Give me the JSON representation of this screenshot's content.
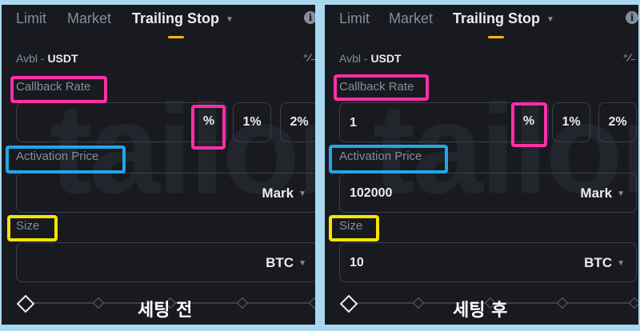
{
  "panels": [
    {
      "tabs": [
        "Limit",
        "Market",
        "Trailing Stop"
      ],
      "active_tab": "Trailing Stop",
      "avbl_label": "Avbl",
      "avbl_currency": "USDT",
      "callback_rate_label": "Callback Rate",
      "callback_value": "",
      "unit_buttons": [
        "%",
        "1%",
        "2%"
      ],
      "activation_price_label": "Activation Price",
      "activation_value": "",
      "activation_suffix": "Mark",
      "size_label": "Size",
      "size_value": "",
      "size_suffix": "BTC",
      "caption": "세팅 전",
      "watermark": "tailong"
    },
    {
      "tabs": [
        "Limit",
        "Market",
        "Trailing Stop"
      ],
      "active_tab": "Trailing Stop",
      "avbl_label": "Avbl",
      "avbl_currency": "USDT",
      "callback_rate_label": "Callback Rate",
      "callback_value": "1",
      "unit_buttons": [
        "%",
        "1%",
        "2%"
      ],
      "activation_price_label": "Activation Price",
      "activation_value": "102000",
      "activation_suffix": "Mark",
      "size_label": "Size",
      "size_value": "10",
      "size_suffix": "BTC",
      "caption": "세팅 후",
      "watermark": "tailong"
    }
  ],
  "icons": {
    "info": "info-icon",
    "swap": "swap-icon",
    "dropdown": "chevron-down-icon"
  },
  "colors": {
    "background": "#a9d8ef",
    "panel": "#181a20",
    "accent": "#f0b90b",
    "highlight_pink": "#ff2fa8",
    "highlight_blue": "#23a6e6",
    "highlight_yellow": "#f5e400"
  }
}
